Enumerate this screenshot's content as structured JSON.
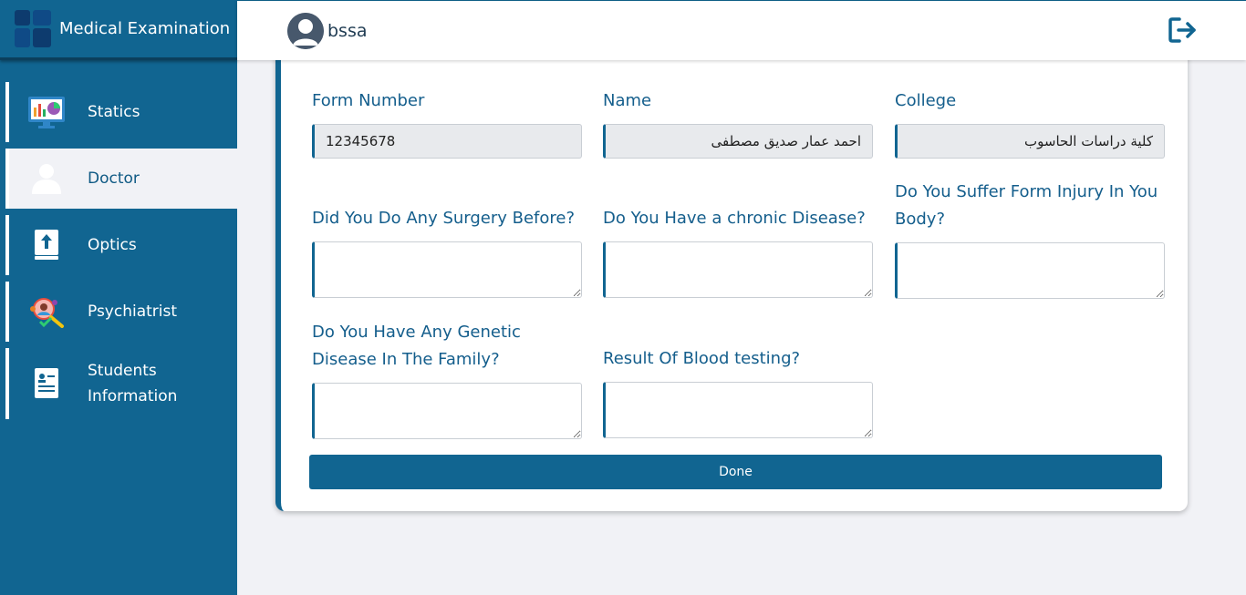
{
  "app": {
    "title": "Medical Examination"
  },
  "sidebar": {
    "items": [
      {
        "label": "Statics",
        "icon": "chart-monitor-icon"
      },
      {
        "label": "Doctor",
        "icon": "doctor-icon",
        "active": true
      },
      {
        "label": "Optics",
        "icon": "upload-book-icon"
      },
      {
        "label": "Psychiatrist",
        "icon": "psychiatrist-icon"
      },
      {
        "label": "Students Information",
        "icon": "student-card-icon"
      }
    ]
  },
  "header": {
    "username": "bssa",
    "logout_icon": "logout-icon"
  },
  "form": {
    "form_number": {
      "label": "Form Number",
      "value": "12345678"
    },
    "name": {
      "label": "Name",
      "value": "احمد عمار صديق مصطفى"
    },
    "college": {
      "label": "College",
      "value": "كلية دراسات الحاسوب"
    },
    "surgery": {
      "label": "Did You Do Any Surgery Before?"
    },
    "chronic": {
      "label": "Do You Have a chronic Disease?"
    },
    "injury": {
      "label": "Do You Suffer Form Injury In You Body?"
    },
    "genetic": {
      "label": "Do You Have Any Genetic Disease In The Family?"
    },
    "blood": {
      "label": "Result Of Blood testing?"
    },
    "done_label": "Done"
  },
  "colors": {
    "primary": "#116591",
    "background": "#f1f2f6"
  }
}
